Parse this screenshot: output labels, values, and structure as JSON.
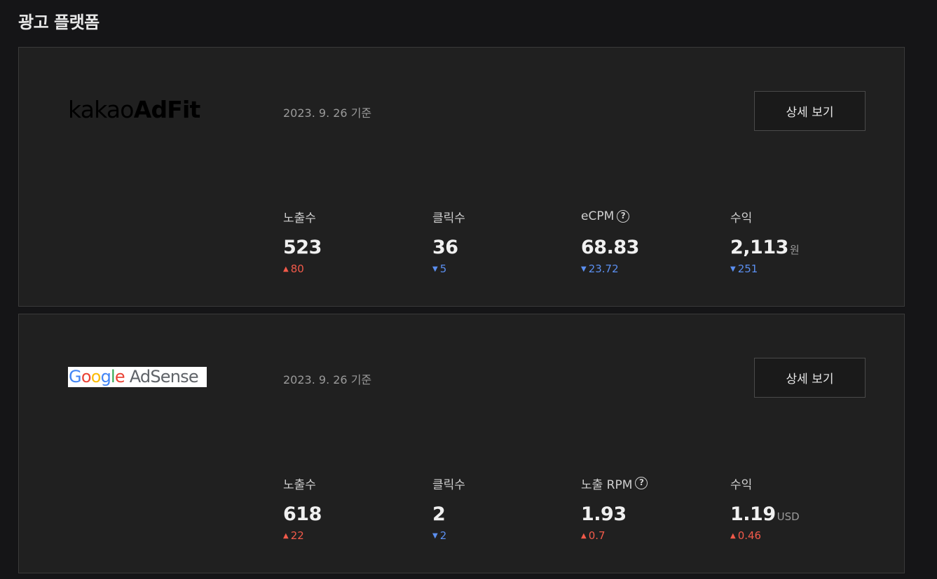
{
  "page": {
    "title": "광고 플랫폼"
  },
  "colors": {
    "background": "#151517",
    "card": "#202020",
    "up": "#f25a4a",
    "down": "#5b8ff0"
  },
  "platforms": [
    {
      "logo": {
        "part1": "kakao",
        "part2": "AdFit"
      },
      "date": "2023. 9. 26 기준",
      "detail_label": "상세 보기",
      "metrics": [
        {
          "label": "노출수",
          "value": "523",
          "unit": "",
          "change": "80",
          "direction": "up",
          "icon": "triangle-up-icon"
        },
        {
          "label": "클릭수",
          "value": "36",
          "unit": "",
          "change": "5",
          "direction": "down",
          "icon": "triangle-down-icon"
        },
        {
          "label": "eCPM",
          "value": "68.83",
          "unit": "",
          "change": "23.72",
          "direction": "down",
          "icon": "triangle-down-icon",
          "help": "?"
        },
        {
          "label": "수익",
          "value": "2,113",
          "unit": "원",
          "change": "251",
          "direction": "down",
          "icon": "triangle-down-icon"
        }
      ]
    },
    {
      "logo": {
        "g1": "G",
        "g2": "o",
        "g3": "o",
        "g4": "g",
        "g5": "l",
        "g6": "e",
        "rest": " AdSense"
      },
      "date": "2023. 9. 26 기준",
      "detail_label": "상세 보기",
      "metrics": [
        {
          "label": "노출수",
          "value": "618",
          "unit": "",
          "change": "22",
          "direction": "up",
          "icon": "triangle-up-icon"
        },
        {
          "label": "클릭수",
          "value": "2",
          "unit": "",
          "change": "2",
          "direction": "down",
          "icon": "triangle-down-icon"
        },
        {
          "label": "노출 RPM",
          "value": "1.93",
          "unit": "",
          "change": "0.7",
          "direction": "up",
          "icon": "triangle-up-icon",
          "help": "?"
        },
        {
          "label": "수익",
          "value": "1.19",
          "unit": "USD",
          "change": "0.46",
          "direction": "up",
          "icon": "triangle-up-icon"
        }
      ]
    }
  ]
}
